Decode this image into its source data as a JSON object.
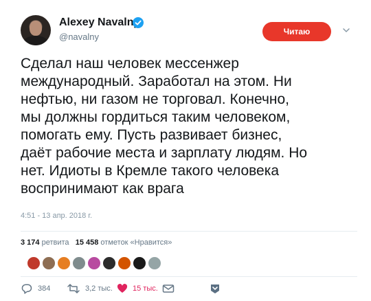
{
  "author": {
    "name": "Alexey Navalny",
    "handle": "@navalny",
    "verified": true
  },
  "follow_button": {
    "label": "Читаю",
    "color": "#e8372a"
  },
  "tweet": {
    "lines": [
      "Сделал наш человек мессенжер",
      "международный. Заработал на этом. Ни",
      "нефтью, ни газом не торговал. Конечно,",
      "мы должны гордиться таким человеком,",
      "помогать ему. Пусть развивает бизнес,",
      "даёт рабочие места и зарплату людям. Но",
      "нет. Идиоты в Кремле такого человека",
      "воспринимают как врага"
    ],
    "timestamp": "4:51 - 13 апр. 2018 г."
  },
  "stats": {
    "retweets_count": "3 174",
    "retweets_label": "ретвита",
    "likes_count": "15 458",
    "likes_label": "отметок «Нравится»"
  },
  "liker_avatars": [
    {
      "color": "#c0392b"
    },
    {
      "color": "#8e6e53"
    },
    {
      "color": "#e67e22"
    },
    {
      "color": "#7f8c8d"
    },
    {
      "color": "#b84aa0"
    },
    {
      "color": "#2c2c2c"
    },
    {
      "color": "#d35400"
    },
    {
      "color": "#1a1a1a"
    },
    {
      "color": "#95a5a6"
    }
  ],
  "actions": {
    "reply_count": "384",
    "retweet_count": "3,2 тыс.",
    "like_count": "15 тыс.",
    "like_color": "#e0245e"
  }
}
